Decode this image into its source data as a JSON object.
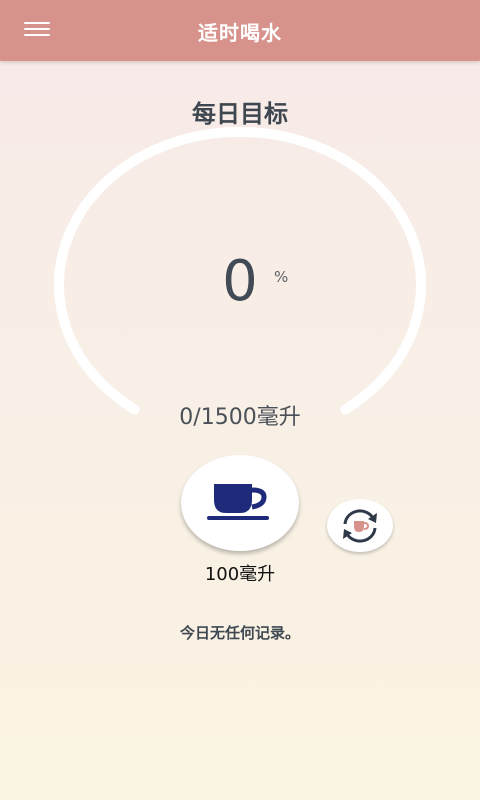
{
  "header": {
    "title": "适时喝水"
  },
  "goal": {
    "title": "每日目标",
    "percent": "0",
    "percent_sign": "%",
    "progress_fraction": 0,
    "amount_text": "0/1500毫升"
  },
  "cup": {
    "label": "100毫升"
  },
  "records": {
    "empty_text": "今日无任何记录。"
  },
  "icons": {
    "menu": "menu-icon",
    "cup": "coffee-cup-icon",
    "switch": "swap-cup-icon"
  },
  "colors": {
    "header": "#d7928c",
    "cup": "#1f2b7a",
    "ring": "#ffffff",
    "switch_cup": "#d7928c"
  }
}
